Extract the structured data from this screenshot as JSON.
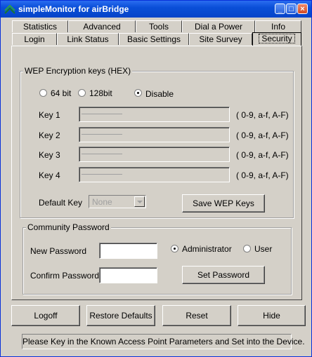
{
  "window": {
    "title": "simpleMonitor for airBridge",
    "minimize_icon": "minimize-icon",
    "maximize_icon": "maximize-icon",
    "close_icon": "close-icon"
  },
  "tabs": {
    "row1": [
      "Statistics",
      "Advanced",
      "Tools",
      "Dial a Power",
      "Info"
    ],
    "row2": [
      "Login",
      "Link Status",
      "Basic Settings",
      "Site Survey",
      "Security"
    ],
    "active": "Security"
  },
  "wep": {
    "legend": "WEP Encryption keys (HEX)",
    "options": [
      "64 bit",
      "128bit",
      "Disable"
    ],
    "selected": "Disable",
    "keys": [
      {
        "label": "Key 1",
        "hint": "( 0-9, a-f, A-F)"
      },
      {
        "label": "Key 2",
        "hint": "( 0-9, a-f, A-F)"
      },
      {
        "label": "Key 3",
        "hint": "( 0-9, a-f, A-F)"
      },
      {
        "label": "Key 4",
        "hint": "( 0-9, a-f, A-F)"
      }
    ],
    "default_key_label": "Default Key",
    "default_key_value": "None",
    "save_button": "Save WEP Keys"
  },
  "community": {
    "legend": "Community Password",
    "new_password_label": "New Password",
    "confirm_password_label": "Confirm Password",
    "new_password_value": "",
    "confirm_password_value": "",
    "roles": [
      "Administrator",
      "User"
    ],
    "selected_role": "Administrator",
    "set_button": "Set Password"
  },
  "footer_buttons": [
    "Logoff",
    "Restore Defaults",
    "Reset",
    "Hide"
  ],
  "status_text": "Please Key in the Known Access Point Parameters and Set into the Device."
}
